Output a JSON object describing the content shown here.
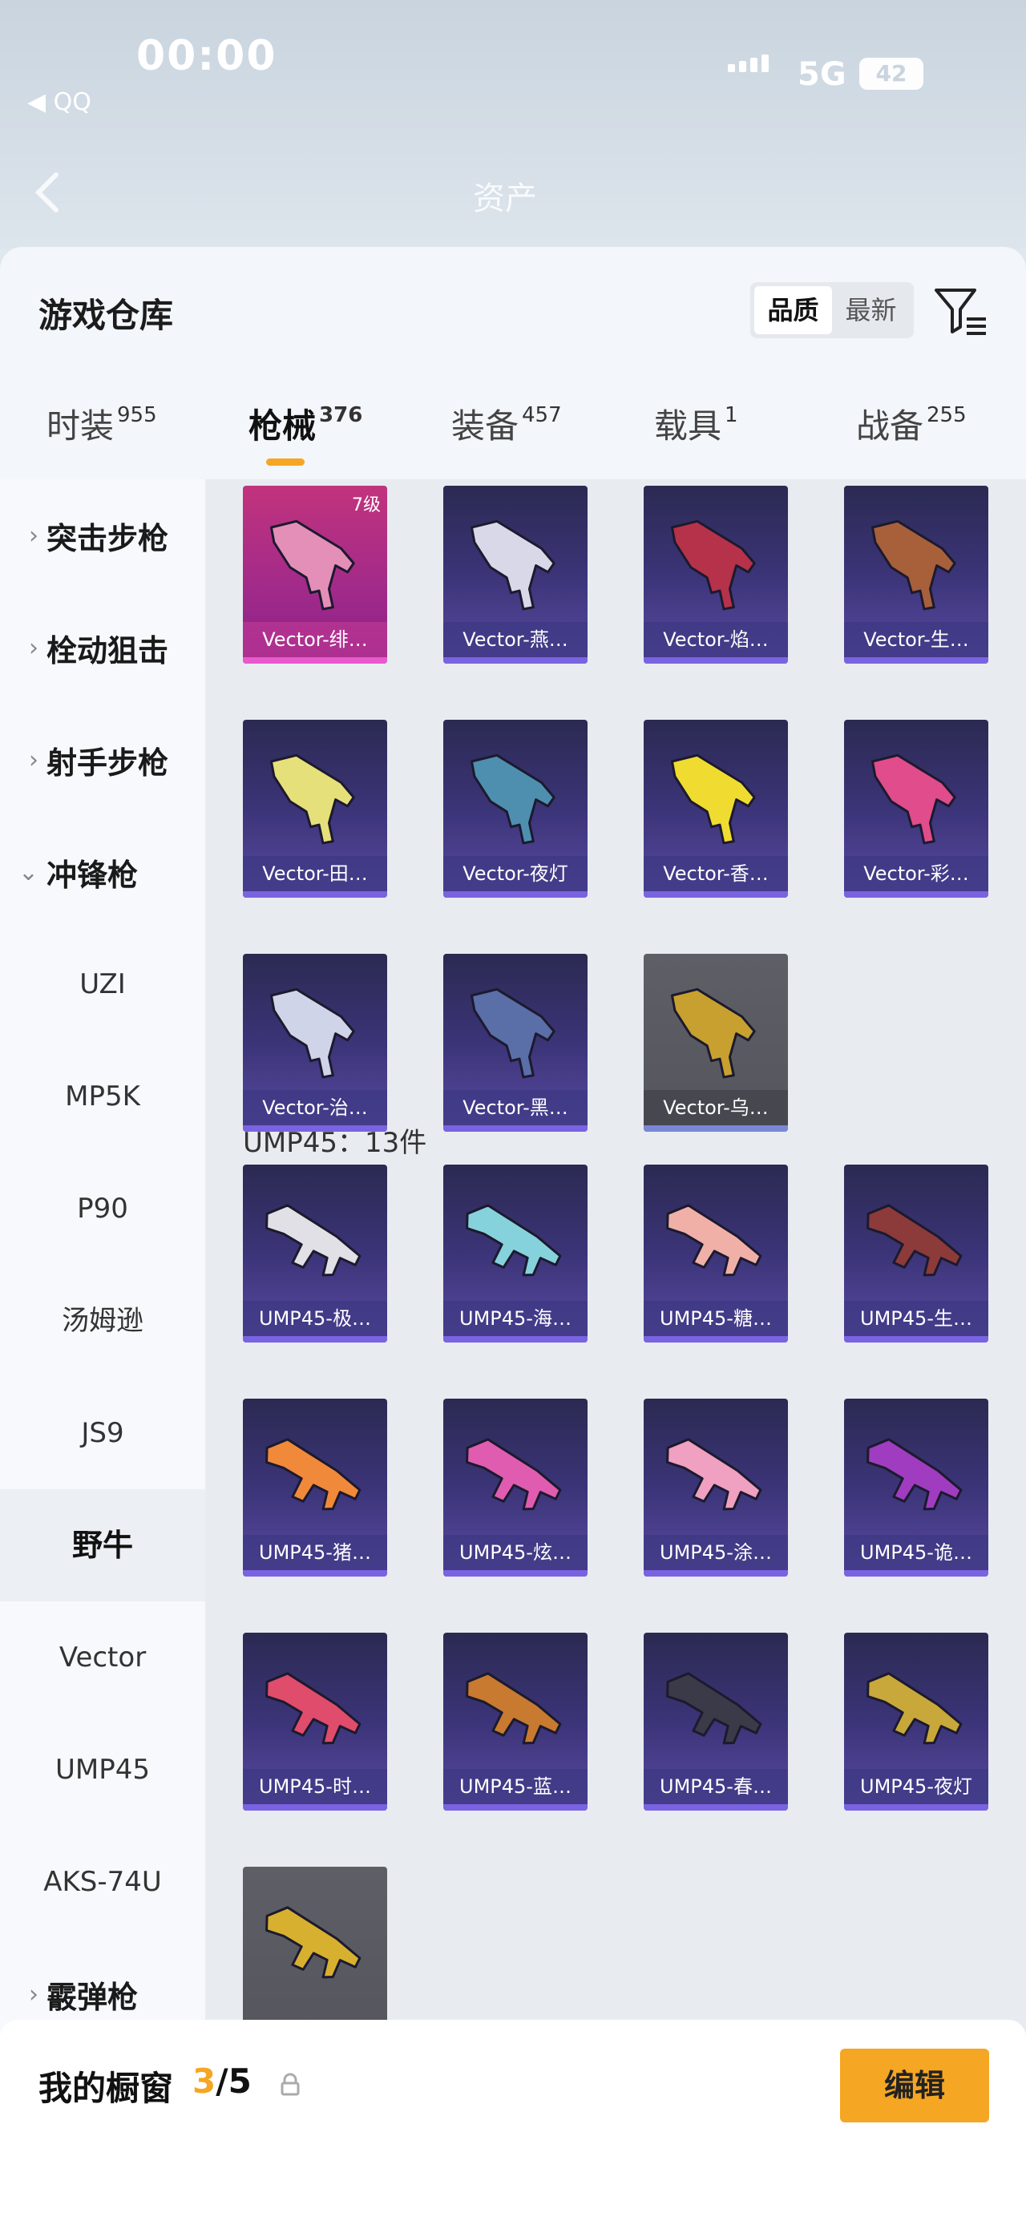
{
  "status": {
    "time": "00:00",
    "back_app": "◀ QQ",
    "network": "5G",
    "battery": "42"
  },
  "topnav": {
    "title": "资产"
  },
  "sheet": {
    "title": "游戏仓库"
  },
  "sort": {
    "options": [
      "品质",
      "最新"
    ],
    "selected": "品质"
  },
  "tabs": [
    {
      "label": "时装",
      "count": "955"
    },
    {
      "label": "枪械",
      "count": "376"
    },
    {
      "label": "装备",
      "count": "457"
    },
    {
      "label": "载具",
      "count": "1"
    },
    {
      "label": "战备",
      "count": "255"
    }
  ],
  "sidebar": {
    "categories": [
      {
        "label": "突击步枪",
        "chevron": "›"
      },
      {
        "label": "栓动狙击",
        "chevron": "›"
      },
      {
        "label": "射手步枪",
        "chevron": "›"
      },
      {
        "label": "冲锋枪",
        "chevron": "⌄"
      }
    ],
    "subitems": [
      "UZI",
      "MP5K",
      "P90",
      "汤姆逊",
      "JS9",
      "野牛",
      "Vector",
      "UMP45",
      "AKS-74U"
    ],
    "bottom_category": {
      "label": "霰弹枪",
      "chevron": "›"
    }
  },
  "vector_items": [
    {
      "name": "Vector-绯…",
      "level": "7级",
      "style": "pink",
      "color": "#e38fb8"
    },
    {
      "name": "Vector-燕…",
      "style": "purple",
      "color": "#d8d8e8"
    },
    {
      "name": "Vector-焰…",
      "style": "purple",
      "color": "#b5324a"
    },
    {
      "name": "Vector-生…",
      "style": "purple",
      "color": "#a8603a"
    },
    {
      "name": "Vector-田…",
      "style": "purple",
      "color": "#e6e07a"
    },
    {
      "name": "Vector-夜灯",
      "style": "purple",
      "color": "#4e8fb0"
    },
    {
      "name": "Vector-香…",
      "style": "purple",
      "color": "#f0dc30"
    },
    {
      "name": "Vector-彩…",
      "style": "purple",
      "color": "#e04c8c"
    },
    {
      "name": "Vector-治…",
      "style": "purple",
      "color": "#d0d4e8"
    },
    {
      "name": "Vector-黑…",
      "style": "purple",
      "color": "#5a6ea8"
    },
    {
      "name": "Vector-乌…",
      "style": "grey",
      "color": "#c8a030"
    }
  ],
  "ump_section_label": "UMP45：13件",
  "ump_items": [
    {
      "name": "UMP45-极…",
      "style": "purple",
      "color": "#e0e0e6"
    },
    {
      "name": "UMP45-海…",
      "style": "purple",
      "color": "#86d2dc"
    },
    {
      "name": "UMP45-糖…",
      "style": "purple",
      "color": "#f0b0a8"
    },
    {
      "name": "UMP45-生…",
      "style": "purple",
      "color": "#8c3a3a"
    },
    {
      "name": "UMP45-猪…",
      "style": "purple",
      "color": "#f08a3a"
    },
    {
      "name": "UMP45-炫…",
      "style": "purple",
      "color": "#e05cb0"
    },
    {
      "name": "UMP45-涂…",
      "style": "purple",
      "color": "#f0a0c0"
    },
    {
      "name": "UMP45-诡…",
      "style": "purple",
      "color": "#a03cc0"
    },
    {
      "name": "UMP45-时…",
      "style": "purple",
      "color": "#e04c6c"
    },
    {
      "name": "UMP45-蓝…",
      "style": "purple",
      "color": "#c87a30"
    },
    {
      "name": "UMP45-春…",
      "style": "purple",
      "color": "#3a3a48"
    },
    {
      "name": "UMP45-夜灯",
      "style": "purple",
      "color": "#c8a83a"
    },
    {
      "name": "",
      "style": "grey",
      "color": "#d8b030"
    }
  ],
  "showcase": {
    "label": "我的橱窗",
    "current": "3",
    "total": "/5",
    "edit_label": "编辑"
  },
  "colors": {
    "accent": "#f5a623",
    "card_purple": "#3b3478",
    "card_pink": "#c2337d"
  }
}
